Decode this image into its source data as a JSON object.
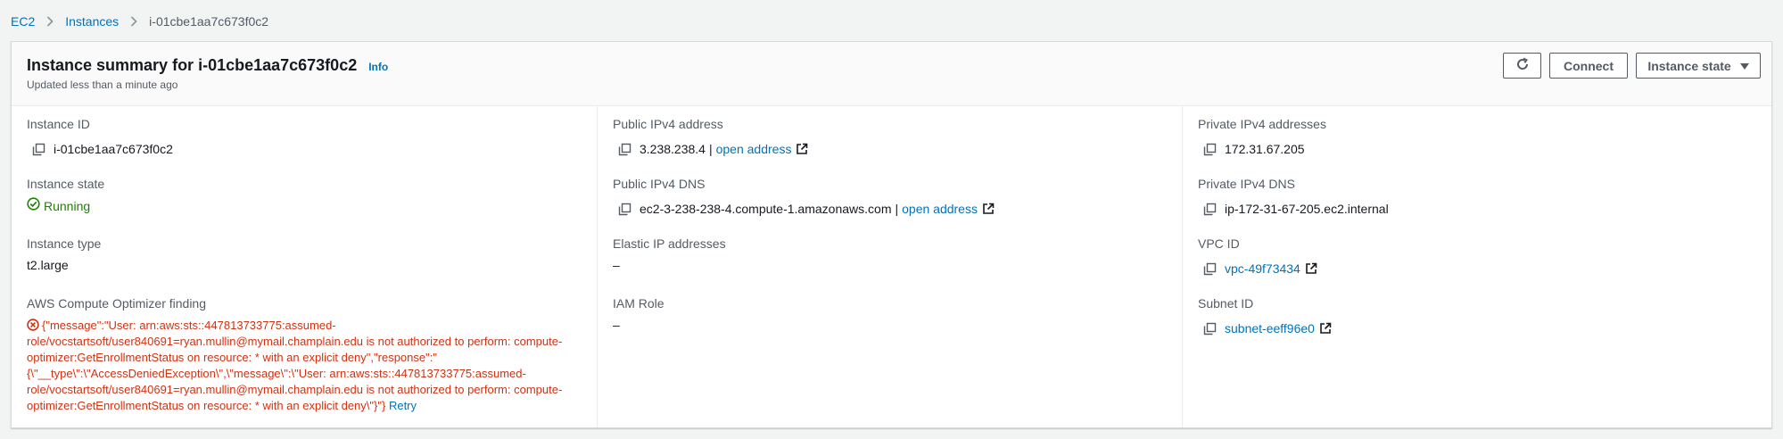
{
  "breadcrumb": {
    "items": [
      "EC2",
      "Instances"
    ],
    "current": "i-01cbe1aa7c673f0c2"
  },
  "header": {
    "title": "Instance summary for i-01cbe1aa7c673f0c2",
    "info": "Info",
    "subtitle": "Updated less than a minute ago",
    "refresh_icon": "refresh-icon",
    "connect_label": "Connect",
    "instance_state_label": "Instance state"
  },
  "col1": {
    "instance_id_label": "Instance ID",
    "instance_id": "i-01cbe1aa7c673f0c2",
    "instance_state_label": "Instance state",
    "instance_state": "Running",
    "instance_type_label": "Instance type",
    "instance_type": "t2.large",
    "optimizer_label": "AWS Compute Optimizer finding",
    "optimizer_error": "{\"message\":\"User: arn:aws:sts::447813733775:assumed-role/vocstartsoft/user840691=ryan.mullin@mymail.champlain.edu is not authorized to perform: compute-optimizer:GetEnrollmentStatus on resource: * with an explicit deny\",\"response\":\"{\\\"__type\\\":\\\"AccessDeniedException\\\",\\\"message\\\":\\\"User: arn:aws:sts::447813733775:assumed-role/vocstartsoft/user840691=ryan.mullin@mymail.champlain.edu is not authorized to perform: compute-optimizer:GetEnrollmentStatus on resource: * with an explicit deny\\\"}\"}",
    "retry": "Retry"
  },
  "col2": {
    "public_ipv4_label": "Public IPv4 address",
    "public_ipv4": "3.238.238.4",
    "public_ipv4_sep": "|",
    "open_address_1": "open address",
    "public_dns_label": "Public IPv4 DNS",
    "public_dns": "ec2-3-238-238-4.compute-1.amazonaws.com",
    "public_dns_sep": "|",
    "open_address_2": "open address",
    "elastic_ip_label": "Elastic IP addresses",
    "elastic_ip": "–",
    "iam_role_label": "IAM Role",
    "iam_role": "–"
  },
  "col3": {
    "private_ipv4_label": "Private IPv4 addresses",
    "private_ipv4": "172.31.67.205",
    "private_dns_label": "Private IPv4 DNS",
    "private_dns": "ip-172-31-67-205.ec2.internal",
    "vpc_label": "VPC ID",
    "vpc_id": "vpc-49f73434",
    "subnet_label": "Subnet ID",
    "subnet_id": "subnet-eeff96e0"
  },
  "colors": {
    "link": "#0073bb",
    "success": "#1d8102",
    "error": "#d13212"
  }
}
